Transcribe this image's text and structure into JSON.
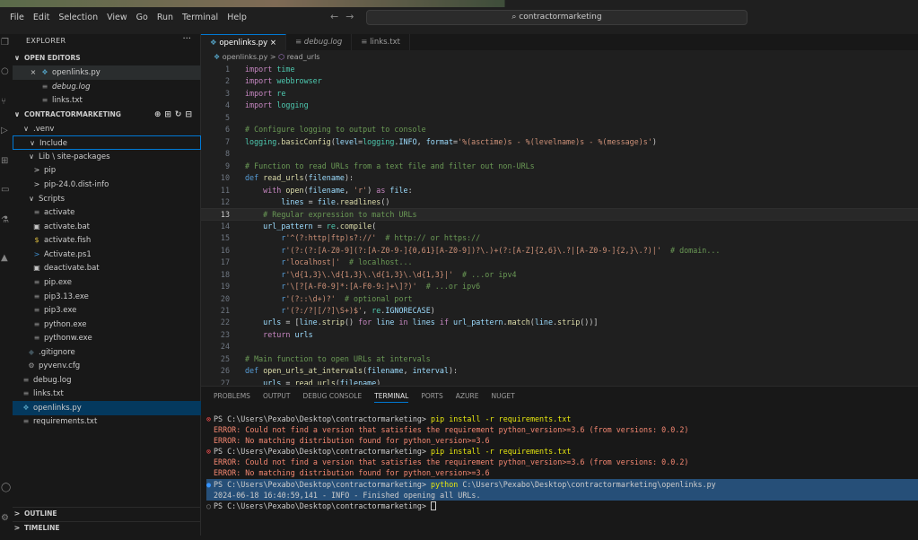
{
  "menubar": [
    "File",
    "Edit",
    "Selection",
    "View",
    "Go",
    "Run",
    "Terminal",
    "Help"
  ],
  "search": {
    "text": "contractormarketing"
  },
  "explorer": {
    "title": "EXPLORER",
    "more": "···",
    "open_editors_label": "OPEN EDITORS",
    "open_editors": [
      {
        "name": "openlinks.py",
        "close": "×",
        "icon": "py"
      },
      {
        "name": "debug.log",
        "icon": "txt"
      },
      {
        "name": "links.txt",
        "icon": "txt"
      }
    ],
    "project_label": "CONTRACTORMARKETING",
    "tree": [
      {
        "label": ".venv",
        "arrow": "∨"
      },
      {
        "label": "Include",
        "arrow": "∨"
      },
      {
        "label": "Lib \\ site-packages",
        "arrow": "∨"
      },
      {
        "label": "pip",
        "arrow": ">"
      },
      {
        "label": "pip-24.0.dist-info",
        "arrow": ">"
      },
      {
        "label": "Scripts",
        "arrow": "∨"
      },
      {
        "label": "activate",
        "icon": "txt"
      },
      {
        "label": "activate.bat",
        "icon": "bat"
      },
      {
        "label": "activate.fish",
        "icon": "fish"
      },
      {
        "label": "Activate.ps1",
        "icon": "ps1"
      },
      {
        "label": "deactivate.bat",
        "icon": "bat"
      },
      {
        "label": "pip.exe",
        "icon": "txt"
      },
      {
        "label": "pip3.13.exe",
        "icon": "txt"
      },
      {
        "label": "pip3.exe",
        "icon": "txt"
      },
      {
        "label": "python.exe",
        "icon": "txt"
      },
      {
        "label": "pythonw.exe",
        "icon": "txt"
      },
      {
        "label": ".gitignore",
        "icon": "git"
      },
      {
        "label": "pyvenv.cfg",
        "icon": "cfg"
      },
      {
        "label": "debug.log",
        "icon": "txt"
      },
      {
        "label": "links.txt",
        "icon": "txt"
      },
      {
        "label": "openlinks.py",
        "icon": "py"
      },
      {
        "label": "requirements.txt",
        "icon": "txt"
      }
    ],
    "outline_label": "OUTLINE",
    "timeline_label": "TIMELINE"
  },
  "tabs": [
    {
      "label": "openlinks.py",
      "close": "×"
    },
    {
      "label": "debug.log"
    },
    {
      "label": "links.txt"
    }
  ],
  "breadcrumb": {
    "file": "openlinks.py",
    "sep": ">",
    "symbol": "read_urls"
  },
  "code_lines": [
    "1",
    "2",
    "3",
    "4",
    "5",
    "6",
    "7",
    "8",
    "9",
    "10",
    "11",
    "12",
    "13",
    "14",
    "15",
    "16",
    "17",
    "18",
    "19",
    "20",
    "21",
    "22",
    "23",
    "24",
    "25",
    "26",
    "27"
  ],
  "panel_tabs": [
    "PROBLEMS",
    "OUTPUT",
    "DEBUG CONSOLE",
    "TERMINAL",
    "PORTS",
    "AZURE",
    "NUGET"
  ],
  "terminal": {
    "prompt": "PS C:\\Users\\Pexabo\\Desktop\\contractormarketing>",
    "cmd1": "pip install -r requirements.txt",
    "err1": "ERROR: Could not find a version that satisfies the requirement python_version>=3.6 (from versions: 0.0.2)",
    "err2": "ERROR: No matching distribution found for python_version>=3.6",
    "cmd3_prog": "python",
    "cmd3_arg": "C:\\Users\\Pexabo\\Desktop\\contractormarketing\\openlinks.py",
    "log": "2024-06-18 16:40:59,141 - INFO - Finished opening all URLs."
  }
}
